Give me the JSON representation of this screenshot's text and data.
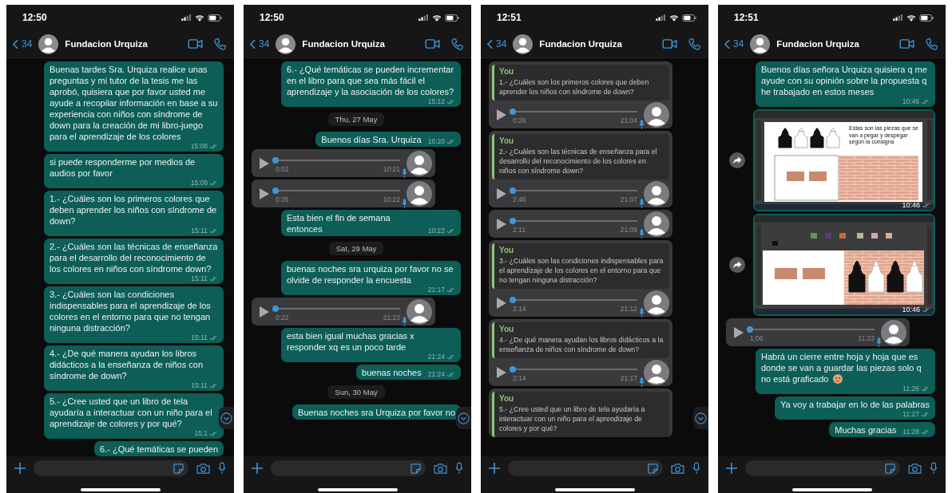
{
  "panels": [
    {
      "status_time": "12:50",
      "back_count": "34",
      "contact": "Fundacion Urquiza",
      "scroll_down_button": true,
      "messages": [
        {
          "kind": "text",
          "text": "Buenas tardes Sra. Urquiza realice unas preguntas y mi tutor de la tesis me las aprobó, quisiera que por favor usted me ayude a recopilar información en base a su experiencia con niños con síndrome de down para la creación de mi libro-juego para el aprendizaje de los colores",
          "time": "15:08"
        },
        {
          "kind": "text",
          "text": "si puede responderme por medios de audios por favor",
          "time": "15:09"
        },
        {
          "kind": "text",
          "text": "1.- ¿Cuáles son los primeros colores que deben aprender los niños con síndrome de down?",
          "time": "15:11"
        },
        {
          "kind": "text",
          "text": "2.- ¿Cuáles son las técnicas de enseñanza para el desarrollo del reconocimiento de los colores en niños con síndrome down?",
          "time": "15:11"
        },
        {
          "kind": "text",
          "text": "3.- ¿Cuáles son las condiciones indispensables para el aprendizaje de los colores en el entorno para que no tengan ninguna distracción?",
          "time": "15:11"
        },
        {
          "kind": "text",
          "text": "4.- ¿De qué manera ayudan los libros didácticos a la enseñanza de niños con síndrome de down?",
          "time": "15:11"
        },
        {
          "kind": "text",
          "text": "5.- ¿Cree usted que un libro de tela ayudaría a interactuar con un niño para el aprendizaje de colores y por qué?",
          "time": "15:1"
        },
        {
          "kind": "text",
          "text": "6.- ¿Qué temáticas se pueden"
        }
      ]
    },
    {
      "status_time": "12:50",
      "back_count": "34",
      "contact": "Fundacion Urquiza",
      "scroll_down_button": true,
      "messages": [
        {
          "kind": "text",
          "text": "6.- ¿Qué temáticas se pueden incrementar en el libro para que sea más fácil el aprendizaje y la asociación de los colores?",
          "time": "15:12"
        },
        {
          "kind": "date",
          "text": "Thu, 27 May"
        },
        {
          "kind": "text",
          "text": "Buenos días Sra. Urquiza",
          "time": "10:20"
        },
        {
          "kind": "voice",
          "duration": "0:02",
          "time": "10:21",
          "level": 0
        },
        {
          "kind": "voice",
          "duration": "0:35",
          "time": "10:22",
          "level": 0
        },
        {
          "kind": "text",
          "text": "Esta bien el fin de semana entonces",
          "time": "10:22"
        },
        {
          "kind": "date",
          "text": "Sat, 29 May"
        },
        {
          "kind": "text",
          "text": "buenas noches sra urquiza por favor no se olvide de responder la encuesta",
          "time": "21:17"
        },
        {
          "kind": "voice",
          "duration": "0:22",
          "time": "21:23",
          "level": 0
        },
        {
          "kind": "text",
          "text": "esta bien igual muchas gracias x responder xq es un poco tarde",
          "time": "21:24"
        },
        {
          "kind": "text",
          "text": "buenas noches",
          "time": "21:24"
        },
        {
          "kind": "date",
          "text": "Sun, 30 May"
        },
        {
          "kind": "text",
          "text": "Buenas noches sra Urquiza por favor no"
        }
      ]
    },
    {
      "status_time": "12:51",
      "back_count": "34",
      "contact": "Fundacion Urquiza",
      "scroll_down_button": true,
      "messages": [
        {
          "kind": "quoted_voice",
          "quote_author": "You",
          "quote": "1.- ¿Cuáles son los primeros colores que deben aprender los niños con síndrome de down?",
          "duration": "0:26",
          "time": "21:04",
          "level": 0
        },
        {
          "kind": "quoted_voice",
          "quote_author": "You",
          "quote": "2.- ¿Cuáles son las técnicas de enseñanza para el desarrollo del reconocimiento de los colores en niños con síndrome down?",
          "duration": "2:46",
          "time": "21:07",
          "level": 0
        },
        {
          "kind": "voice",
          "duration": "2:11",
          "time": "21:09",
          "level": 0
        },
        {
          "kind": "quoted_voice",
          "quote_author": "You",
          "quote": "3.- ¿Cuáles son las condiciones indispensables para el aprendizaje de los colores en el entorno para que no tengan ninguna distracción?",
          "duration": "2:14",
          "time": "21:12",
          "level": 0
        },
        {
          "kind": "quoted_voice",
          "quote_author": "You",
          "quote": "4.- ¿De qué manera ayudan los libros didácticos a la enseñanza de niños con síndrome de down?",
          "duration": "2:14",
          "time": "21:17",
          "level": 0
        },
        {
          "kind": "quoted_voice",
          "quote_author": "You",
          "quote": "5.- ¿Cree usted que un libro de tela ayudaría a interactuar con un niño para el aprendizaje de colores y por qué?"
        }
      ]
    },
    {
      "status_time": "12:51",
      "back_count": "34",
      "contact": "Fundacion Urquiza",
      "messages": [
        {
          "kind": "text",
          "text": "Buenos días señora Urquiza quisiera q me ayude con su opinión sobre la propuesta q he trabajado en estos meses",
          "time": "10:46"
        },
        {
          "kind": "image_pieces",
          "caption": "Estas son las piezas que se van a pegar y despegar según la consigna",
          "time": "10:46"
        },
        {
          "kind": "image_wall",
          "time": "10:46"
        },
        {
          "kind": "voice",
          "duration": "1:06",
          "time": "11:23",
          "level": 0
        },
        {
          "kind": "text",
          "text": "Habrá un cierre entre hoja y hoja que es donde se van a guardar las piezas solo q no está graficado",
          "emoji": true,
          "time": "11:26"
        },
        {
          "kind": "text",
          "text": "Ya voy a trabajar en lo de las palabras",
          "time": "11:27"
        },
        {
          "kind": "text",
          "text": "Muchas gracias",
          "time": "11:28"
        }
      ]
    }
  ]
}
